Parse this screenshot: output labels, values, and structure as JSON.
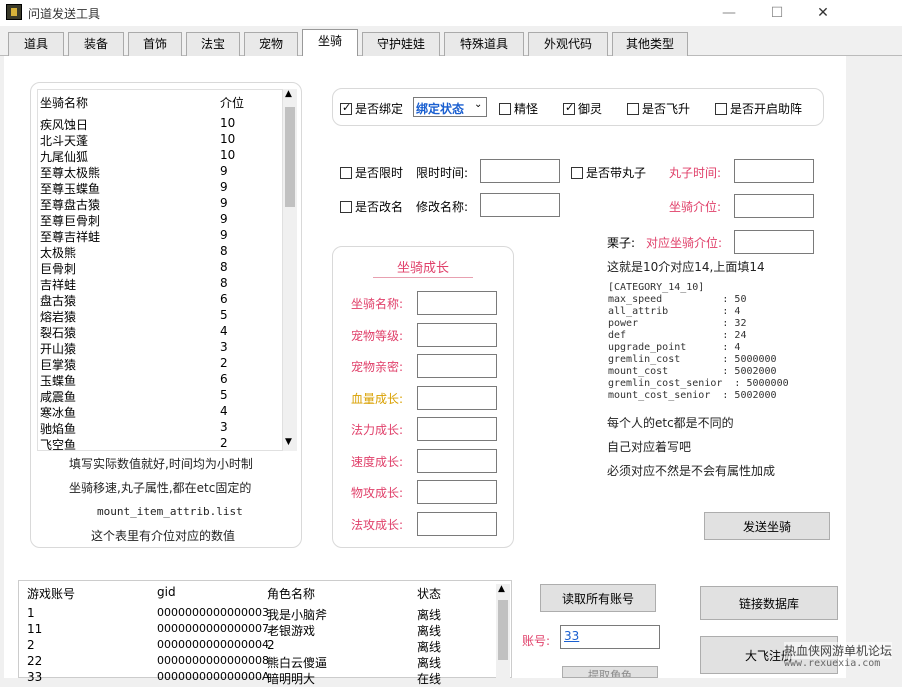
{
  "window": {
    "title": "问道发送工具",
    "minimize": "—",
    "maximize": "☐",
    "close": "✕"
  },
  "tabs": [
    "道具",
    "装备",
    "首饰",
    "法宝",
    "宠物",
    "坐骑",
    "守护娃娃",
    "特殊道具",
    "外观代码",
    "其他类型"
  ],
  "active_tab": 5,
  "mount_list": {
    "headers": [
      "坐骑名称",
      "介位"
    ],
    "rows": [
      [
        "疾风蚀日",
        "10"
      ],
      [
        "北斗天蓬",
        "10"
      ],
      [
        "九尾仙狐",
        "10"
      ],
      [
        "至尊太极熊",
        "9"
      ],
      [
        "至尊玉蝶鱼",
        "9"
      ],
      [
        "至尊盘古猿",
        "9"
      ],
      [
        "至尊巨骨刺",
        "9"
      ],
      [
        "至尊吉祥蛙",
        "9"
      ],
      [
        "太极熊",
        "8"
      ],
      [
        "巨骨刺",
        "8"
      ],
      [
        "吉祥蛙",
        "8"
      ],
      [
        "盘古猿",
        "6"
      ],
      [
        "熔岩猿",
        "5"
      ],
      [
        "裂石猿",
        "4"
      ],
      [
        "开山猿",
        "3"
      ],
      [
        "巨掌猿",
        "2"
      ],
      [
        "玉蝶鱼",
        "6"
      ],
      [
        "咸震鱼",
        "5"
      ],
      [
        "寒冰鱼",
        "4"
      ],
      [
        "驰焰鱼",
        "3"
      ],
      [
        "飞空鱼",
        "2"
      ]
    ],
    "notes": [
      "填写实际数值就好,时间均为小时制",
      "坐骑移速,丸子属性,都在etc固定的",
      "mount_item_attrib.list",
      "这个表里有介位对应的数值"
    ]
  },
  "options": {
    "bind_label": "是否绑定",
    "bind_checked": true,
    "bind_select": "绑定状态",
    "spirit_label": "精怪",
    "spirit_checked": false,
    "yuling_label": "御灵",
    "yuling_checked": true,
    "fly_label": "是否飞升",
    "fly_checked": false,
    "assist_label": "是否开启助阵",
    "assist_checked": false
  },
  "limit": {
    "limit_label": "是否限时",
    "limit_time_label": "限时时间:",
    "pill_label": "是否带丸子",
    "pill_time_label": "丸子时间:",
    "rename_label": "是否改名",
    "rename_field_label": "修改名称:",
    "level_label": "坐骑介位:",
    "chestnut_label": "栗子:",
    "chestnut_field_label": "对应坐骑介位:",
    "explain": "这就是10介对应14,上面填14"
  },
  "growth": {
    "title": "坐骑成长",
    "fields": [
      "坐骑名称:",
      "宠物等级:",
      "宠物亲密:",
      "血量成长:",
      "法力成长:",
      "速度成长:",
      "物攻成长:",
      "法攻成长:"
    ]
  },
  "category_block": [
    "[CATEGORY_14_10]",
    "max_speed          : 50",
    "all_attrib         : 4",
    "power              : 32",
    "def                : 24",
    "upgrade_point      : 4",
    "gremlin_cost       : 5000000",
    "mount_cost         : 5002000",
    "gremlin_cost_senior  : 5000000",
    "mount_cost_senior  : 5002000"
  ],
  "etc_notes": [
    "每个人的etc都是不同的",
    "自己对应着写吧",
    "必须对应不然是不会有属性加成"
  ],
  "send_button": "发送坐骑",
  "accounts": {
    "headers": [
      "游戏账号",
      "gid",
      "角色名称",
      "状态"
    ],
    "rows": [
      [
        "1",
        "0000000000000003",
        "我是小脑斧",
        "离线"
      ],
      [
        "11",
        "0000000000000007",
        "老银游戏",
        "离线"
      ],
      [
        "2",
        "0000000000000004",
        "2",
        "离线"
      ],
      [
        "22",
        "0000000000000008",
        "熊白云傻逼",
        "离线"
      ],
      [
        "33",
        "000000000000000A",
        "暗明明大",
        "在线"
      ]
    ]
  },
  "account_panel": {
    "read_all": "读取所有账号",
    "account_label": "账号:",
    "account_value": "33",
    "link_db": "链接数据库",
    "register": "大飞注册",
    "extra_btn": "提取角色"
  },
  "watermark": {
    "line1": "热血侠网游单机论坛",
    "line2": "www.rexuexia.com"
  }
}
